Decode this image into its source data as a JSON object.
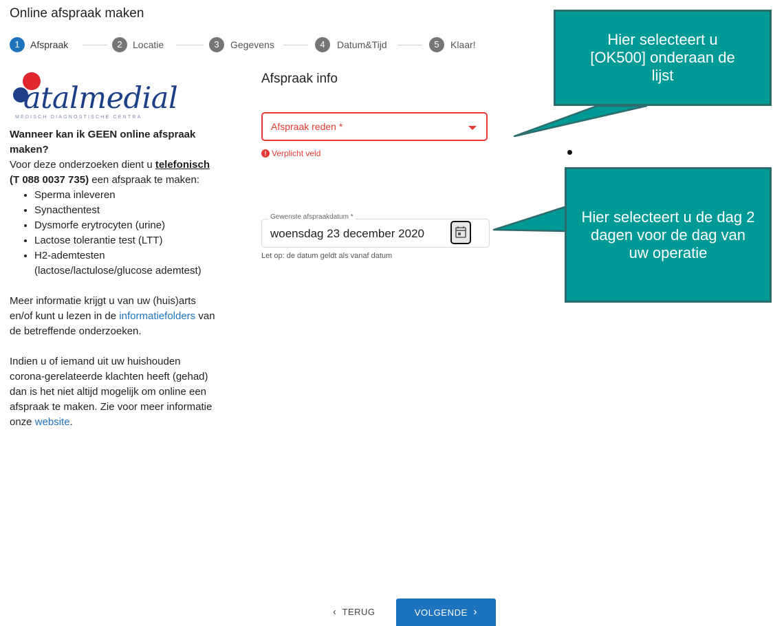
{
  "page": {
    "title": "Online afspraak maken"
  },
  "stepper": [
    {
      "num": "1",
      "label": "Afspraak"
    },
    {
      "num": "2",
      "label": "Locatie"
    },
    {
      "num": "3",
      "label": "Gegevens"
    },
    {
      "num": "4",
      "label": "Datum&Tijd"
    },
    {
      "num": "5",
      "label": "Klaar!"
    }
  ],
  "logo": {
    "name": "atalmedial",
    "subtitle": "MEDISCH DIAGNOSTISCHE CENTRA"
  },
  "info": {
    "heading": "Wanneer kan ik GEEN online afspraak maken?",
    "intro_before": "Voor deze onderzoeken dient u",
    "phone_link": "telefonisch",
    "phone_number": "(T 088 0037 735)",
    "intro_after": "een afspraak te maken:",
    "list": [
      "Sperma inleveren",
      "Synacthentest",
      "Dysmorfe erytrocyten (urine)",
      "Lactose tolerantie test (LTT)",
      "H2-ademtesten (lactose/lactulose/glucose ademtest)"
    ],
    "more_before": "Meer informatie krijgt u van uw (huis)arts en/of kunt u lezen in de",
    "more_link": "informatiefolders",
    "more_after": "van de betreffende onderzoeken.",
    "corona_text": "Indien u of iemand uit uw huishouden corona-gerelateerde klachten heeft (gehad) dan is het niet altijd mogelijk om online een afspraak te maken. Zie voor meer informatie onze",
    "corona_link": "website",
    "corona_end": "."
  },
  "form": {
    "title": "Afspraak info",
    "reason_label": "Afspraak reden *",
    "required_text": "Verplicht veld",
    "date_label": "Gewenste afspraakdatum *",
    "date_value": "woensdag 23 december 2020",
    "date_hint": "Let op: de datum geldt als vanaf datum"
  },
  "callouts": {
    "one": "Hier selecteert u [OK500] onderaan de lijst",
    "two": "Hier selecteert u de dag 2 dagen voor de dag van uw operatie"
  },
  "nav": {
    "back": "TERUG",
    "next": "VOLGENDE"
  },
  "colors": {
    "primary": "#1e73be",
    "error": "#e53935",
    "callout": "#009a96"
  }
}
